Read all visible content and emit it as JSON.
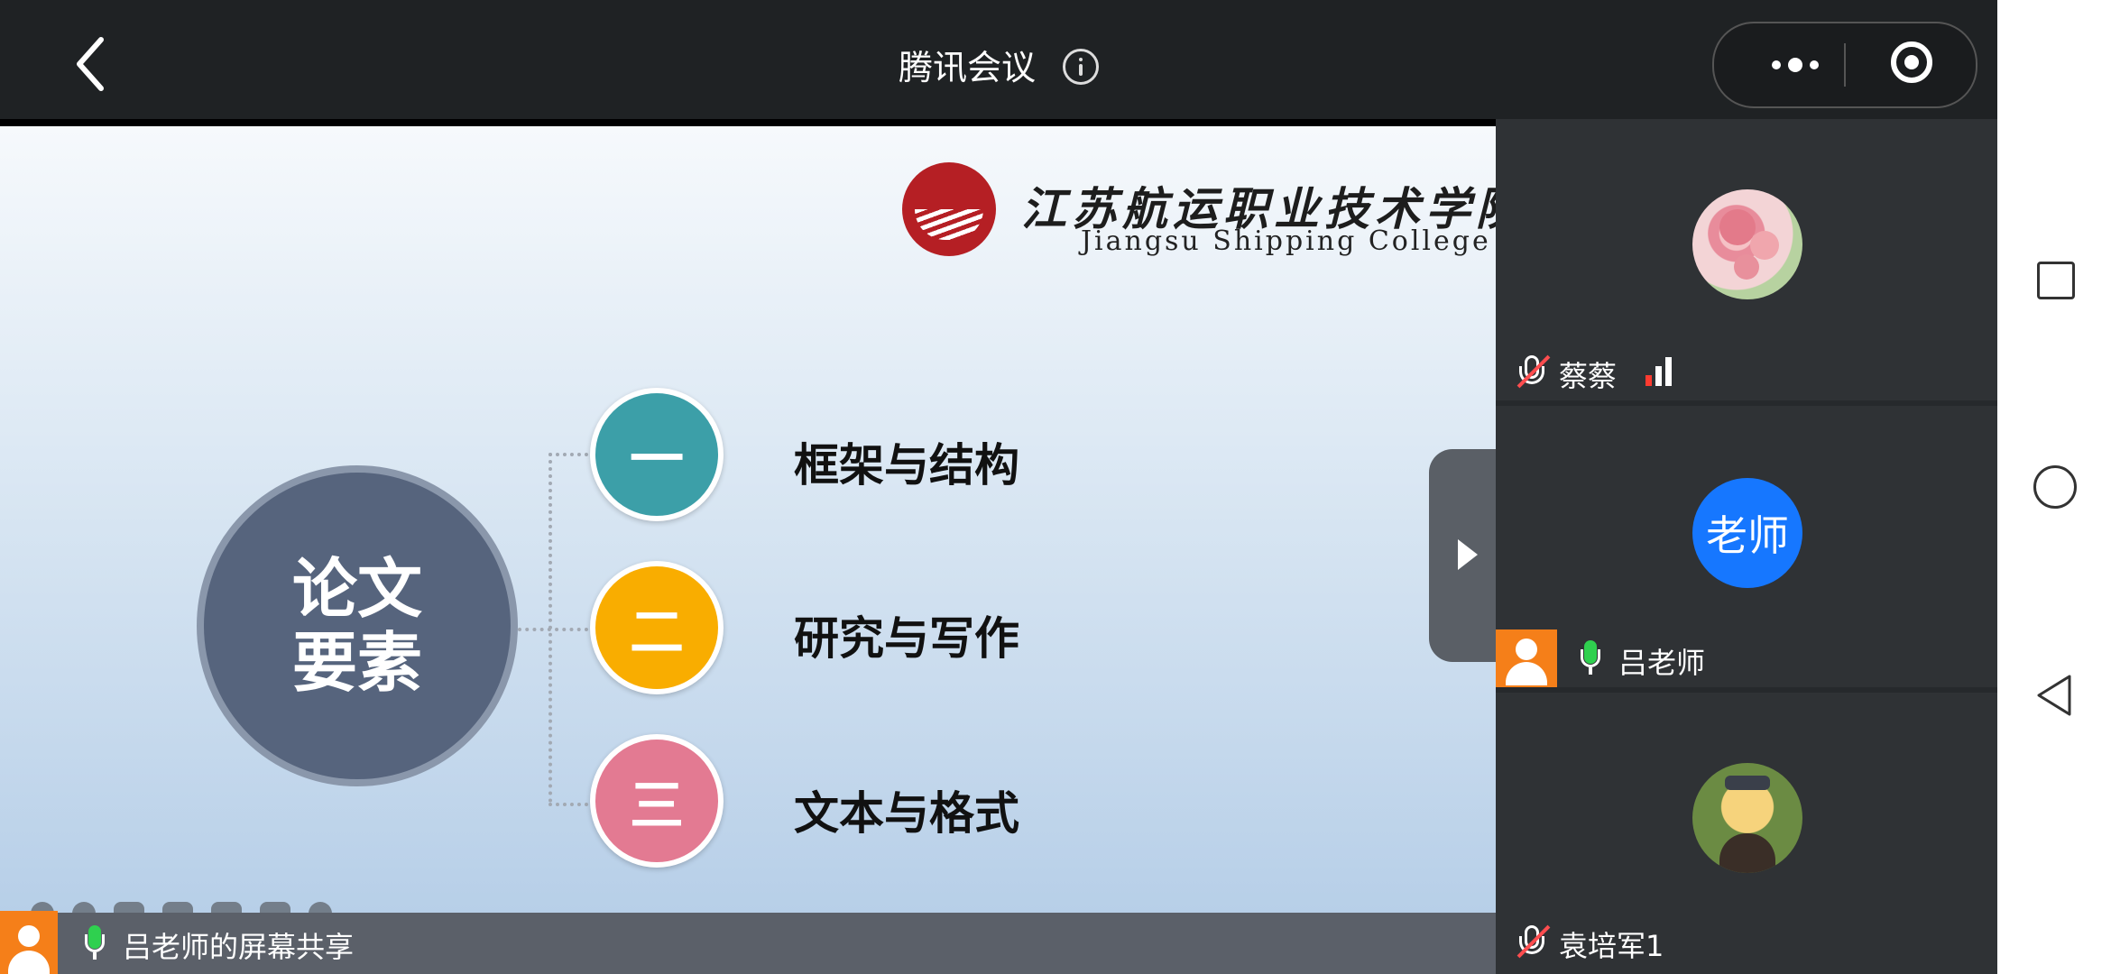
{
  "header": {
    "title": "腾讯会议",
    "back_icon": "chevron-left-icon",
    "info_icon": "info-icon",
    "more_icon": "more-dots-icon",
    "close_icon": "target-close-icon"
  },
  "slide": {
    "college_name_cn": "江苏航运职业技术学院",
    "college_name_en": "Jiangsu Shipping College",
    "center_title_line1": "论文",
    "center_title_line2": "要素",
    "items": [
      {
        "number": "一",
        "label": "框架与结构",
        "color": "#3c9fa8"
      },
      {
        "number": "二",
        "label": "研究与写作",
        "color": "#f9ad00"
      },
      {
        "number": "三",
        "label": "文本与格式",
        "color": "#e37a92"
      }
    ]
  },
  "share_bar": {
    "label": "吕老师的屏幕共享"
  },
  "participants": [
    {
      "name": "蔡蔡",
      "avatar": "rose-photo",
      "mic": "muted",
      "signal": "weak"
    },
    {
      "name": "吕老师",
      "avatar_text": "老师",
      "mic": "active"
    },
    {
      "name": "袁培军1",
      "avatar": "anime-photo",
      "mic": "muted"
    }
  ],
  "colors": {
    "brand_blue": "#1677ff",
    "host_orange": "#f57f19",
    "mic_green": "#2fd04f",
    "muted_red": "#ff4d4f"
  }
}
